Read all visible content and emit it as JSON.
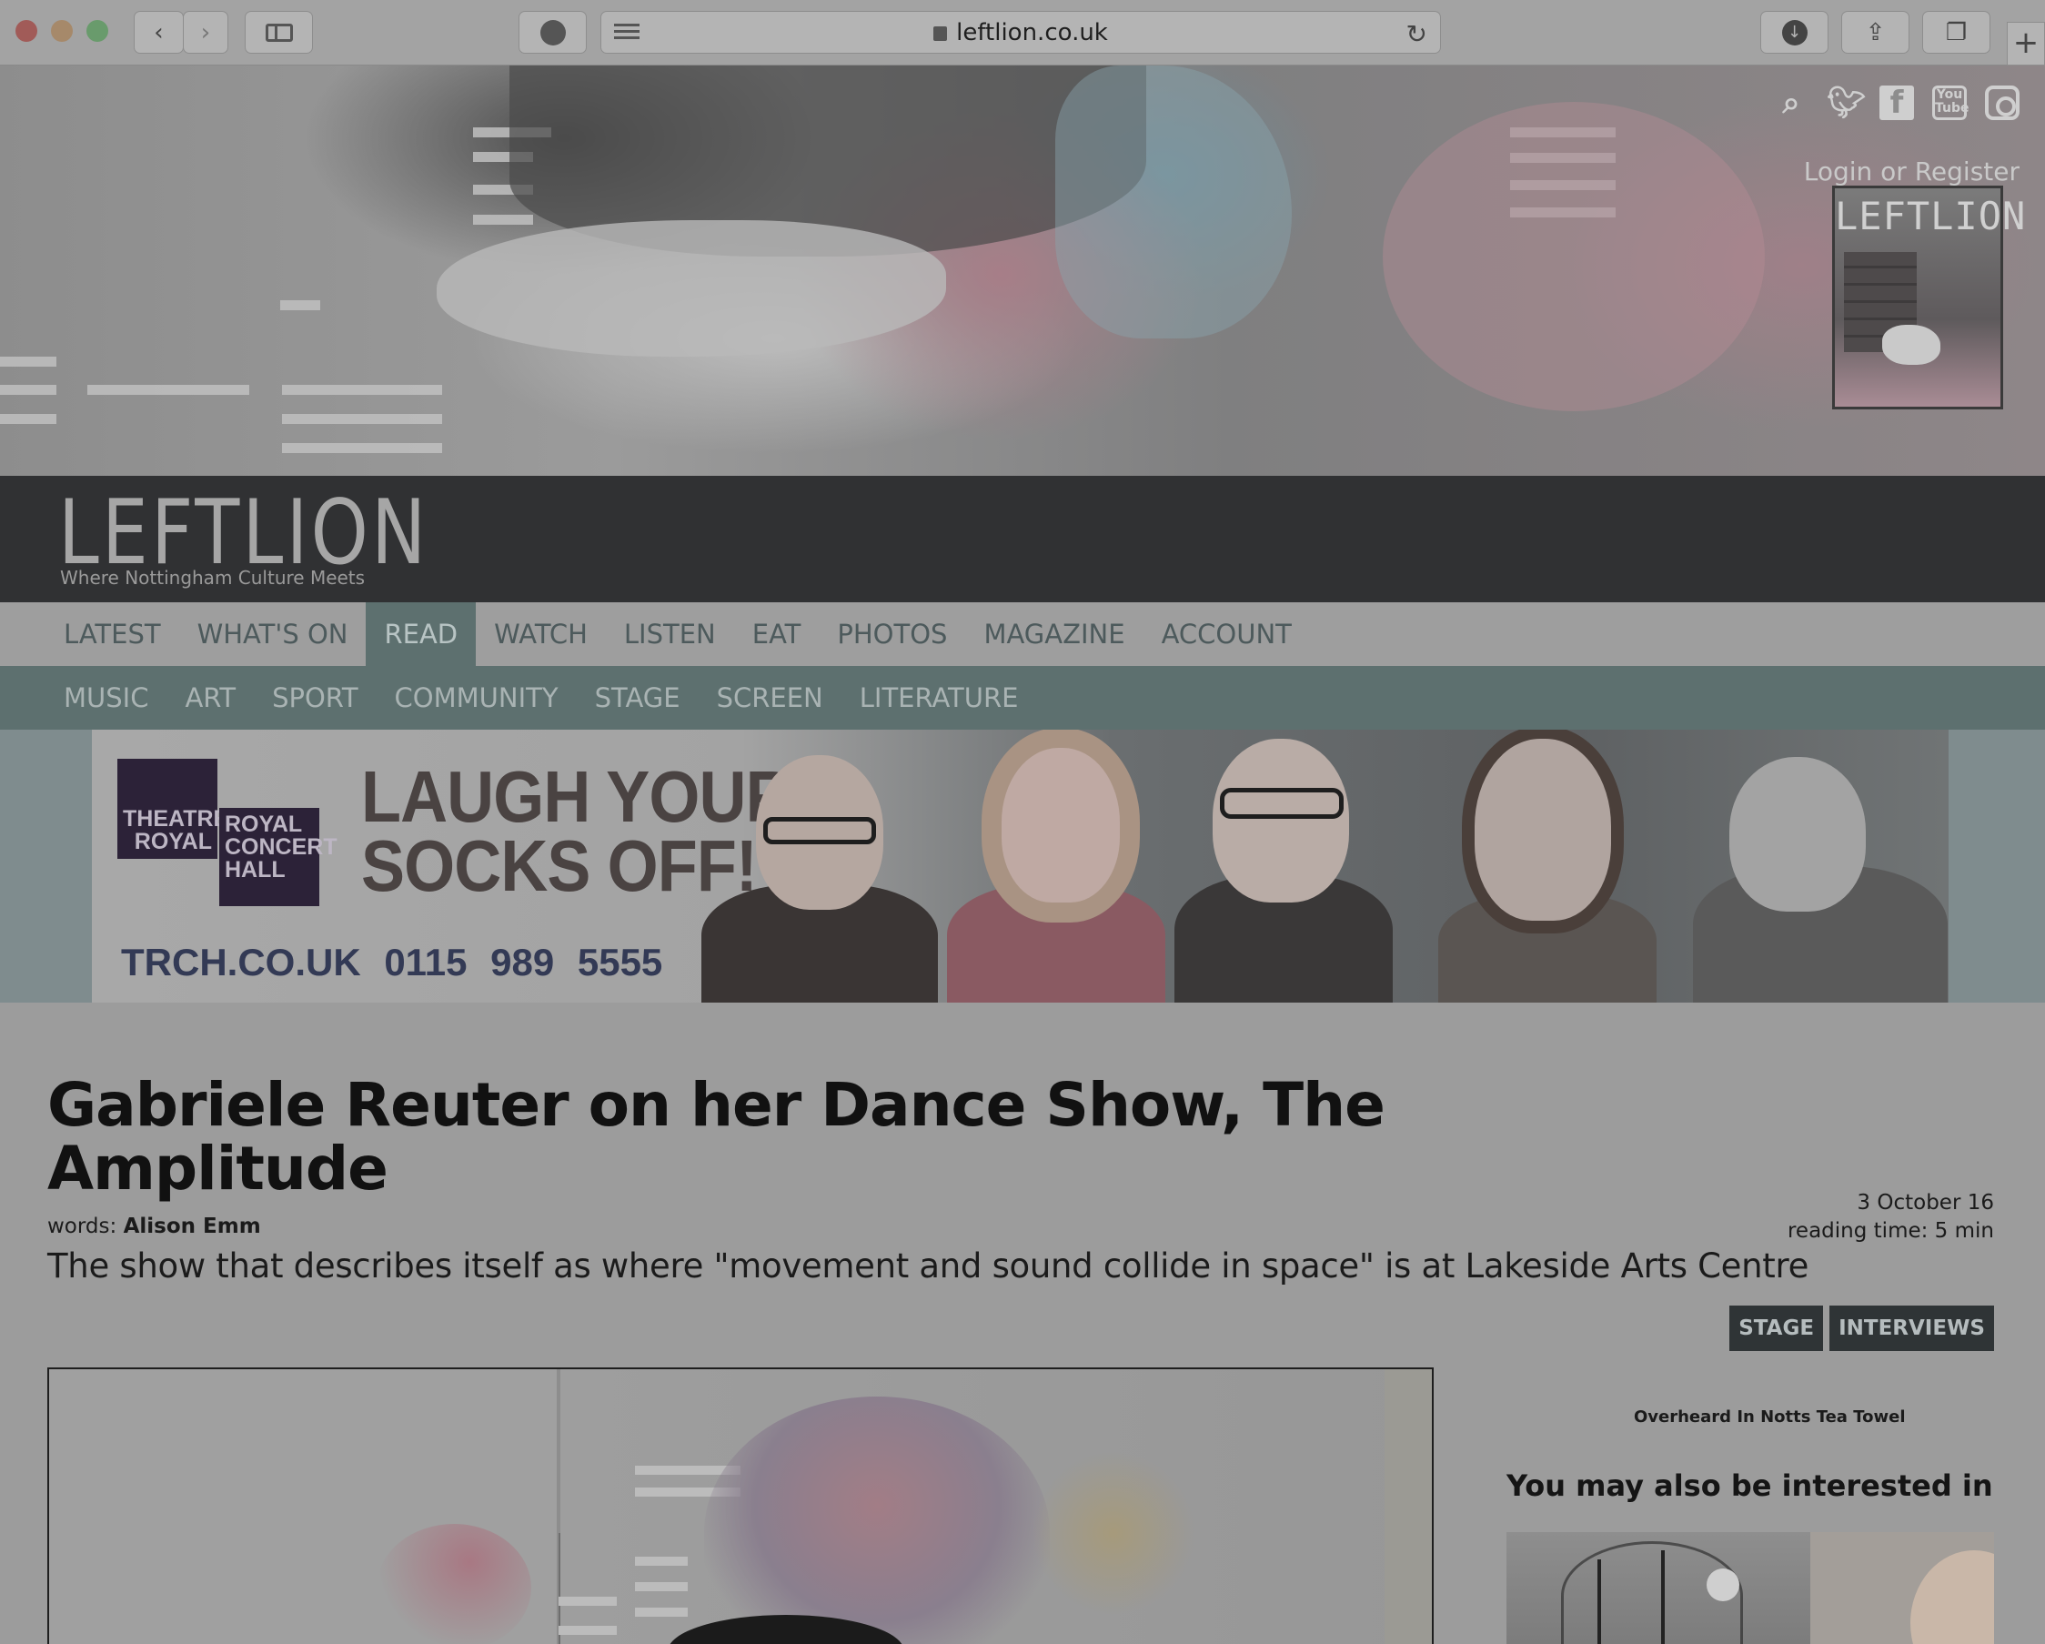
{
  "browser": {
    "url": "leftlion.co.uk"
  },
  "hero": {
    "login_text": "Login or Register",
    "magazine_title": "LEFTLION",
    "social_icons": [
      "search-icon",
      "twitter-icon",
      "facebook-icon",
      "youtube-icon",
      "instagram-icon"
    ]
  },
  "site": {
    "logo": "LEFTLION",
    "tagline": "Where Nottingham Culture Meets"
  },
  "nav": {
    "primary": [
      "LATEST",
      "WHAT'S ON",
      "READ",
      "WATCH",
      "LISTEN",
      "EAT",
      "PHOTOS",
      "MAGAZINE",
      "ACCOUNT"
    ],
    "active": "READ",
    "secondary": [
      "MUSIC",
      "ART",
      "SPORT",
      "COMMUNITY",
      "STAGE",
      "SCREEN",
      "LITERATURE"
    ]
  },
  "banner": {
    "logo_left": [
      "THEATRE",
      "ROYAL"
    ],
    "logo_right": [
      "ROYAL",
      "CONCERT",
      "HALL"
    ],
    "headline_1": "LAUGH YOUR",
    "headline_2": "SOCKS OFF!",
    "website": "TRCH.CO.UK",
    "phone": "0115 989 5555"
  },
  "article": {
    "title": "Gabriele Reuter on her Dance Show, The Amplitude",
    "byline_prefix": "words:",
    "author": "Alison Emm",
    "date": "3 October 16",
    "reading_time": "reading time: 5 min",
    "standfirst": "The show that describes itself as where \"movement and sound collide in space\" is at Lakeside Arts Centre",
    "tags": [
      "STAGE",
      "INTERVIEWS"
    ]
  },
  "sidebar": {
    "promo_text": "Overheard In Notts Tea Towel",
    "related_heading": "You may also be interested in"
  },
  "colors": {
    "nav_teal": "#5d706f",
    "header_dark": "#303133",
    "banner_purple": "#2c2238"
  }
}
